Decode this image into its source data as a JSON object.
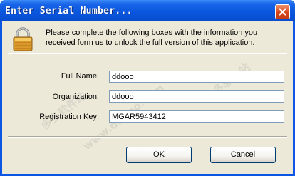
{
  "window": {
    "title": "Enter Serial Number...",
    "close_icon": "close-icon"
  },
  "message": "Please complete the following boxes with the information you received form us to unlock the full version of this application.",
  "fields": {
    "full_name": {
      "label": "Full Name:",
      "value": "ddooo"
    },
    "organization": {
      "label": "Organization:",
      "value": "ddooo"
    },
    "registration_key": {
      "label": "Registration Key:",
      "value": "MGAR5943412"
    }
  },
  "buttons": {
    "ok": "OK",
    "cancel": "Cancel"
  },
  "watermark": [
    "多多软件站",
    "www.ddooo.com",
    "多多软件站"
  ],
  "colors": {
    "titlebar": "#0a57df",
    "client": "#ece9d8",
    "close_button": "#d8461b",
    "lock": "#d99a2b"
  }
}
